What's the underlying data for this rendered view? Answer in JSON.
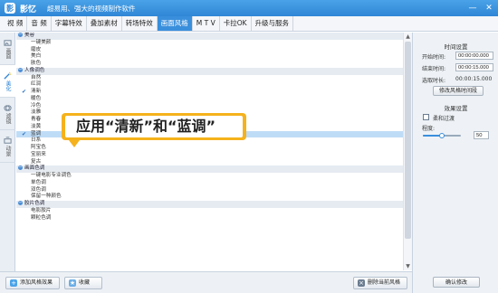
{
  "titlebar": {
    "logo": "影",
    "app_name": "影忆",
    "slogan": "超易用、强大的视频制作软件",
    "minimize": "—",
    "close": "✕"
  },
  "tabs": [
    {
      "label": "视 频",
      "active": false
    },
    {
      "label": "音 频",
      "active": false
    },
    {
      "label": "字幕特效",
      "active": false
    },
    {
      "label": "叠加素材",
      "active": false
    },
    {
      "label": "转场特效",
      "active": false
    },
    {
      "label": "画面风格",
      "active": true
    },
    {
      "label": "M T V",
      "active": false
    },
    {
      "label": "卡拉OK",
      "active": false
    },
    {
      "label": "升级与服务",
      "active": false
    }
  ],
  "vsidebar": [
    {
      "label": "画面",
      "icon": "picture-icon",
      "active": false
    },
    {
      "label": "美化",
      "icon": "magic-wand-icon",
      "active": true
    },
    {
      "label": "滤镜",
      "icon": "filter-icon",
      "active": false
    },
    {
      "label": "动景",
      "icon": "motion-icon",
      "active": false
    }
  ],
  "list": [
    {
      "type": "category",
      "label": "美容"
    },
    {
      "type": "item",
      "label": "一键美颜",
      "checked": false
    },
    {
      "type": "item",
      "label": "磨皮",
      "checked": false
    },
    {
      "type": "item",
      "label": "美白",
      "checked": false
    },
    {
      "type": "item",
      "label": "肤色",
      "checked": false
    },
    {
      "type": "category",
      "label": "人像调色"
    },
    {
      "type": "item",
      "label": "自然",
      "checked": false
    },
    {
      "type": "item",
      "label": "红润",
      "checked": false
    },
    {
      "type": "item",
      "label": "清新",
      "checked": true
    },
    {
      "type": "item",
      "label": "暖色",
      "checked": false
    },
    {
      "type": "item",
      "label": "冷色",
      "checked": false
    },
    {
      "type": "item",
      "label": "淡雅",
      "checked": false
    },
    {
      "type": "item",
      "label": "青春",
      "checked": false
    },
    {
      "type": "item",
      "label": "淡黄",
      "checked": false
    },
    {
      "type": "item",
      "label": "蓝调",
      "checked": true,
      "selected": true
    },
    {
      "type": "item",
      "label": "日系",
      "checked": false
    },
    {
      "type": "item",
      "label": "阿宝色",
      "checked": false
    },
    {
      "type": "item",
      "label": "宝丽来",
      "checked": false
    },
    {
      "type": "item",
      "label": "复古",
      "checked": false
    },
    {
      "type": "category",
      "label": "画面色调"
    },
    {
      "type": "item",
      "label": "一键电影专业调色",
      "checked": false
    },
    {
      "type": "item",
      "label": "单色调",
      "checked": false
    },
    {
      "type": "item",
      "label": "双色调",
      "checked": false
    },
    {
      "type": "item",
      "label": "保留一种颜色",
      "checked": false
    },
    {
      "type": "category",
      "label": "胶片色调"
    },
    {
      "type": "item",
      "label": "电影胶片",
      "checked": false
    },
    {
      "type": "item",
      "label": "颗粒色调",
      "checked": false
    },
    {
      "type": "item",
      "label": "",
      "checked": false
    },
    {
      "type": "item",
      "label": "",
      "checked": false
    },
    {
      "type": "item",
      "label": "",
      "checked": false
    },
    {
      "type": "item",
      "label": "",
      "checked": false
    },
    {
      "type": "item",
      "label": "",
      "checked": false
    },
    {
      "type": "item",
      "label": "",
      "checked": false
    },
    {
      "type": "item",
      "label": "",
      "checked": false
    }
  ],
  "callout": {
    "text": "应用“清新”和“蓝调”"
  },
  "bottombar": {
    "add_style": "添加风格效果",
    "favorite": "收藏",
    "delete_style": "删除当前风格"
  },
  "rightpanel": {
    "time_section": "时间设置",
    "start_label": "开始时间:",
    "start_value": "00:00:00.000",
    "end_label": "结束时间:",
    "end_value": "00:00:15.000",
    "duration_label": "选取时长:",
    "duration_value": "00:00:15.000",
    "modify_time_button": "修改风格时间段",
    "effect_section": "效果设置",
    "soft_transition_label": "柔和过渡",
    "degree_label": "程度:",
    "degree_value": "50",
    "degree_level": 0.5,
    "confirm_button": "确认修改"
  },
  "colors": {
    "accent": "#3a8fdc",
    "callout": "#f5b21c",
    "selected_row": "#bfdcf7"
  }
}
